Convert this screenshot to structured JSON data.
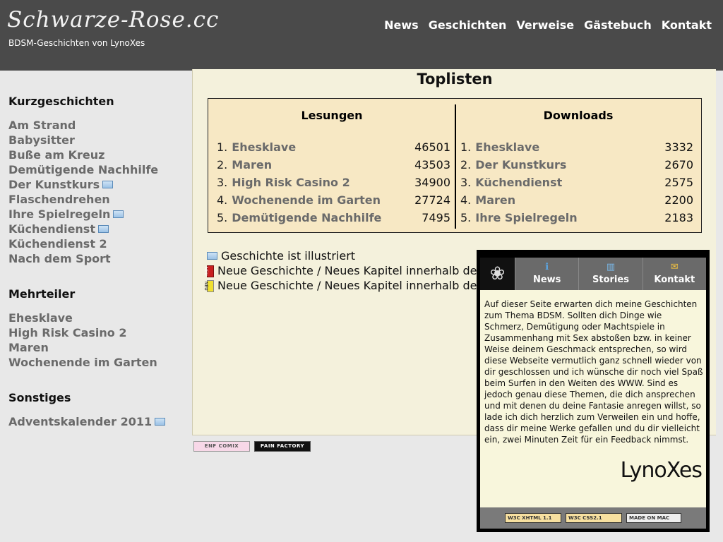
{
  "header": {
    "logo": "Schwarze-Rose.cc",
    "subtitle": "BDSM-Geschichten von LynoXes",
    "nav": [
      "News",
      "Geschichten",
      "Verweise",
      "Gästebuch",
      "Kontakt"
    ]
  },
  "sidebar": {
    "sections": [
      {
        "title": "Kurzgeschichten",
        "items": [
          {
            "label": "Am Strand",
            "illustrated": false
          },
          {
            "label": "Babysitter",
            "illustrated": false
          },
          {
            "label": "Buße am Kreuz",
            "illustrated": false
          },
          {
            "label": "Demütigende Nachhilfe",
            "illustrated": false
          },
          {
            "label": "Der Kunstkurs",
            "illustrated": true
          },
          {
            "label": "Flaschendrehen",
            "illustrated": false
          },
          {
            "label": "Ihre Spielregeln",
            "illustrated": true
          },
          {
            "label": "Küchendienst",
            "illustrated": true
          },
          {
            "label": "Küchendienst 2",
            "illustrated": false
          },
          {
            "label": "Nach dem Sport",
            "illustrated": false
          }
        ]
      },
      {
        "title": "Mehrteiler",
        "items": [
          {
            "label": "Ehesklave",
            "illustrated": false
          },
          {
            "label": "High Risk Casino 2",
            "illustrated": false
          },
          {
            "label": "Maren",
            "illustrated": false
          },
          {
            "label": "Wochenende im Garten",
            "illustrated": false
          }
        ]
      },
      {
        "title": "Sonstiges",
        "items": [
          {
            "label": "Adventskalender 2011",
            "illustrated": true
          }
        ]
      }
    ]
  },
  "main": {
    "title": "Toplisten",
    "lesungen": {
      "heading": "Lesungen",
      "rows": [
        {
          "rank": "1.",
          "title": "Ehesklave",
          "value": "46501"
        },
        {
          "rank": "2.",
          "title": "Maren",
          "value": "43503"
        },
        {
          "rank": "3.",
          "title": "High Risk Casino 2",
          "value": "34900"
        },
        {
          "rank": "4.",
          "title": "Wochenende im Garten",
          "value": "27724"
        },
        {
          "rank": "5.",
          "title": "Demütigende Nachhilfe",
          "value": "7495"
        }
      ]
    },
    "downloads": {
      "heading": "Downloads",
      "rows": [
        {
          "rank": "1.",
          "title": "Ehesklave",
          "value": "3332"
        },
        {
          "rank": "2.",
          "title": "Der Kunstkurs",
          "value": "2670"
        },
        {
          "rank": "3.",
          "title": "Küchendienst",
          "value": "2575"
        },
        {
          "rank": "4.",
          "title": "Maren",
          "value": "2200"
        },
        {
          "rank": "5.",
          "title": "Ihre Spielregeln",
          "value": "2183"
        }
      ]
    },
    "legend": {
      "illustrated": "Geschichte ist illustriert",
      "new_red": "Neue Geschichte / Neues Kapitel innerhalb de",
      "new_yellow": "Neue Geschichte / Neues Kapitel innerhalb de",
      "new_badge": "NEU"
    }
  },
  "banners": {
    "enf": "ENF COMIX",
    "pain": "PAIN FACTORY"
  },
  "popup": {
    "nav": [
      {
        "label": "News",
        "icon": "info-icon"
      },
      {
        "label": "Stories",
        "icon": "book-icon"
      },
      {
        "label": "Kontakt",
        "icon": "mail-icon"
      }
    ],
    "text": "Auf dieser Seite erwarten dich meine Geschichten zum Thema BDSM. Sollten dich Dinge wie Schmerz, Demütigung oder Machtspiele in Zusammenhang mit Sex abstoßen bzw. in keiner Weise deinem Geschmack entsprechen, so wird diese Webseite vermutlich ganz schnell wieder von dir geschlossen und ich wünsche dir noch viel Spaß beim Surfen in den Weiten des WWW. Sind es jedoch genau diese Themen, die dich ansprechen und mit denen du deine Fantasie anregen willst, so lade ich dich herzlich zum Verweilen ein und hoffe, dass dir meine Werke gefallen und du dir vielleicht ein, zwei Minuten Zeit für ein Feedback nimmst.",
    "signature": "LynoXes",
    "badges": [
      "W3C XHTML 1.1",
      "W3C CSS2.1",
      "MADE ON MAC"
    ]
  }
}
